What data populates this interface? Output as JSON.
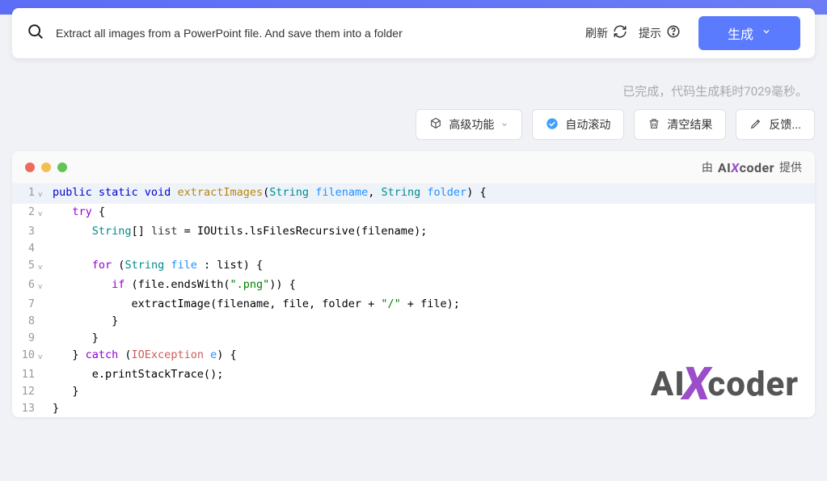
{
  "search": {
    "placeholder": "",
    "value": "Extract all images from a PowerPoint file. And save them into a folder"
  },
  "actions": {
    "refresh": "刷新",
    "hint": "提示",
    "generate": "生成"
  },
  "status": "已完成，代码生成耗时7029毫秒。",
  "toolbar": {
    "advanced": "高级功能",
    "autoscroll": "自动滚动",
    "clear": "清空结果",
    "feedback": "反馈..."
  },
  "provider": {
    "by": "由",
    "brand_a": "AI",
    "brand_x": "X",
    "brand_c": "coder",
    "suffix": "提供"
  },
  "code": {
    "lines": [
      {
        "n": "1",
        "f": "v",
        "hl": true,
        "html": "<span class='kw'>public static void</span> <span class='fn'>extractImages</span>(<span class='ty'>String</span> <span class='var'>filename</span>, <span class='ty'>String</span> <span class='var'>folder</span>) {"
      },
      {
        "n": "2",
        "f": "v",
        "html": "   <span class='kw2'>try</span> {"
      },
      {
        "n": "3",
        "f": "",
        "html": "      <span class='ty'>String</span>[] <span class='pn'>list</span> = IOUtils.lsFilesRecursive(filename);"
      },
      {
        "n": "4",
        "f": "",
        "html": ""
      },
      {
        "n": "5",
        "f": "v",
        "html": "      <span class='kw2'>for</span> (<span class='ty'>String</span> <span class='var'>file</span> : list) {"
      },
      {
        "n": "6",
        "f": "v",
        "html": "         <span class='kw2'>if</span> (file.endsWith(<span class='str'>\".png\"</span>)) {"
      },
      {
        "n": "7",
        "f": "",
        "html": "            extractImage(filename, file, folder + <span class='str'>\"/\"</span> + file);"
      },
      {
        "n": "8",
        "f": "",
        "html": "         }"
      },
      {
        "n": "9",
        "f": "",
        "html": "      }"
      },
      {
        "n": "10",
        "f": "v",
        "html": "   } <span class='kw2'>catch</span> (<span class='ex'>IOException</span> <span class='var'>e</span>) {"
      },
      {
        "n": "11",
        "f": "",
        "html": "      e.printStackTrace();"
      },
      {
        "n": "12",
        "f": "",
        "html": "   }"
      },
      {
        "n": "13",
        "f": "",
        "html": "}"
      }
    ]
  },
  "watermark": {
    "a": "AI",
    "x": "X",
    "c": "coder"
  }
}
